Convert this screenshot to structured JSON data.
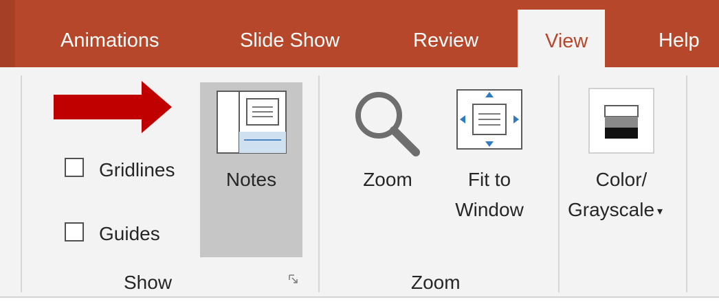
{
  "tabs": [
    {
      "label": "Animations",
      "active": false
    },
    {
      "label": "Slide Show",
      "active": false
    },
    {
      "label": "Review",
      "active": false
    },
    {
      "label": "View",
      "active": true
    },
    {
      "label": "Help",
      "active": false
    }
  ],
  "show_group": {
    "gridlines_label": "Gridlines",
    "gridlines_checked": false,
    "guides_label": "Guides",
    "guides_checked": false,
    "notes_label": "Notes",
    "group_label": "Show"
  },
  "zoom_group": {
    "zoom_label": "Zoom",
    "fit_line1": "Fit to",
    "fit_line2": "Window",
    "group_label": "Zoom"
  },
  "color_group": {
    "color_line1": "Color/",
    "color_line2": "Grayscale",
    "dropdown_glyph": "▾"
  },
  "colors": {
    "tab_bar": "#b7472a",
    "ribbon_bg": "#f3f3f3",
    "pressed_bg": "#c6c6c6",
    "annotation_arrow": "#c00000"
  },
  "icons": [
    "notes-pane-icon",
    "magnifier-icon",
    "fit-window-icon",
    "grayscale-icon",
    "dialog-launcher-icon",
    "red-arrow-annotation"
  ]
}
